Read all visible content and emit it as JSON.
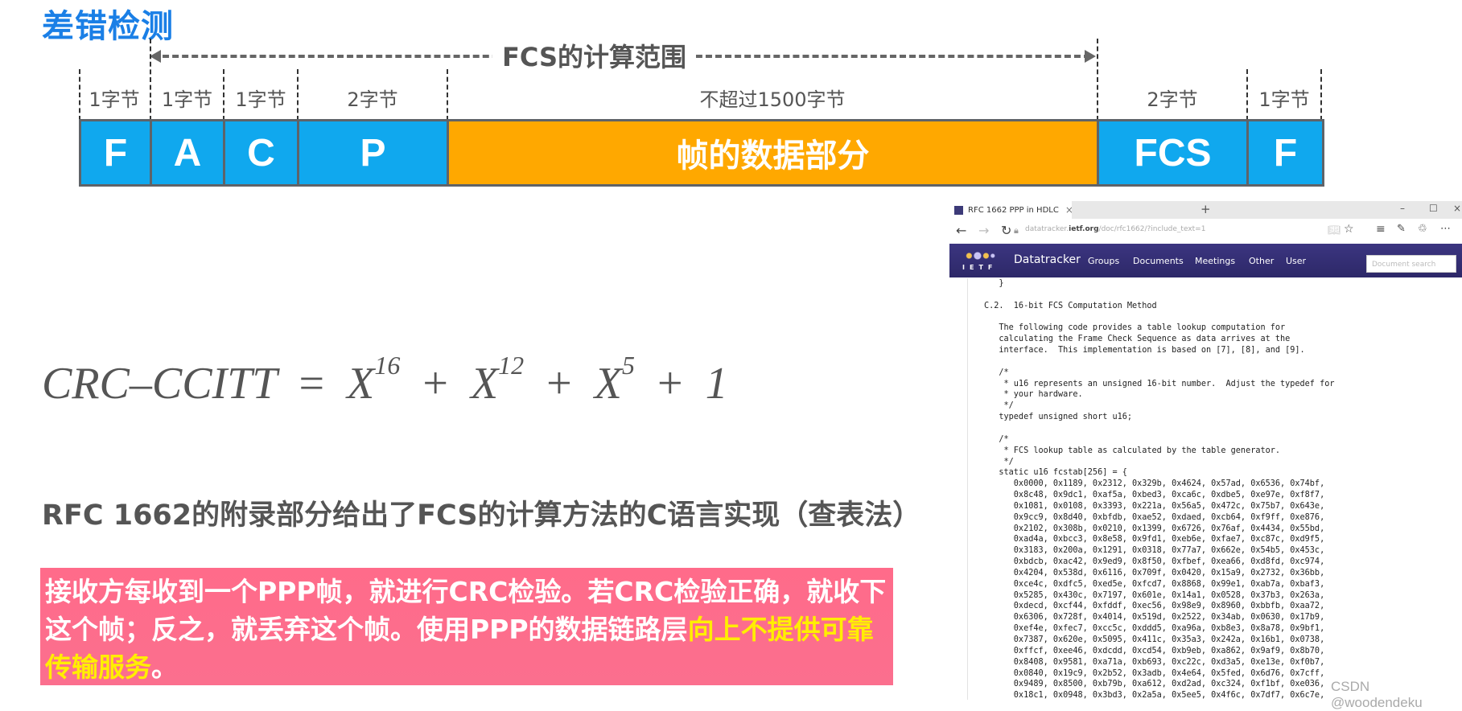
{
  "slide": {
    "title": "差错检测",
    "fcs_range_label": "FCS的计算范围",
    "frame_fields": [
      {
        "label": "F",
        "size": "1字节",
        "color": "#10a8ee"
      },
      {
        "label": "A",
        "size": "1字节",
        "color": "#10a8ee"
      },
      {
        "label": "C",
        "size": "1字节",
        "color": "#10a8ee"
      },
      {
        "label": "P",
        "size": "2字节",
        "color": "#10a8ee"
      },
      {
        "label": "帧的数据部分",
        "size": "不超过1500字节",
        "color": "#ffa800"
      },
      {
        "label": "FCS",
        "size": "2字节",
        "color": "#10a8ee"
      },
      {
        "label": "F",
        "size": "1字节",
        "color": "#10a8ee"
      }
    ],
    "formula": {
      "lhs": "CRC–CCITT",
      "eq": "=",
      "terms": [
        {
          "base": "X",
          "exp": "16"
        },
        {
          "base": "X",
          "exp": "12"
        },
        {
          "base": "X",
          "exp": "5"
        },
        {
          "base": "1",
          "exp": ""
        }
      ],
      "plus": "+"
    },
    "rfc_note": "RFC 1662的附录部分给出了FCS的计算方法的C语言实现（查表法）",
    "conclusion_white": "接收方每收到一个PPP帧，就进行CRC检验。若CRC检验正确，就收下这个帧；反之，就丢弃这个帧。使用PPP的数据链路层",
    "conclusion_yellow": "向上不提供可靠传输服务",
    "conclusion_end": "。",
    "watermark": "CSDN @woodendeku"
  },
  "browser": {
    "tab_title": "RFC 1662   PPP in HDLC",
    "tab_close": "×",
    "new_tab": "+",
    "win_min": "–",
    "win_max": "☐",
    "win_close": "×",
    "url_prefix": "datatracker.",
    "url_domain": "ietf.org",
    "url_path": "/doc/rfc1662/?include_text=1",
    "ietf_logo_text": "IETF",
    "nav": {
      "brand": "Datatracker",
      "items": [
        "Groups",
        "Documents",
        "Meetings",
        "Other",
        "User"
      ]
    },
    "search_placeholder": "Document search",
    "document_text": "   }\n\nC.2.  16-bit FCS Computation Method\n\n   The following code provides a table lookup computation for\n   calculating the Frame Check Sequence as data arrives at the\n   interface.  This implementation is based on [7], [8], and [9].\n\n   /*\n    * u16 represents an unsigned 16-bit number.  Adjust the typedef for\n    * your hardware.\n    */\n   typedef unsigned short u16;\n\n   /*\n    * FCS lookup table as calculated by the table generator.\n    */\n   static u16 fcstab[256] = {\n      0x0000, 0x1189, 0x2312, 0x329b, 0x4624, 0x57ad, 0x6536, 0x74bf,\n      0x8c48, 0x9dc1, 0xaf5a, 0xbed3, 0xca6c, 0xdbe5, 0xe97e, 0xf8f7,\n      0x1081, 0x0108, 0x3393, 0x221a, 0x56a5, 0x472c, 0x75b7, 0x643e,\n      0x9cc9, 0x8d40, 0xbfdb, 0xae52, 0xdaed, 0xcb64, 0xf9ff, 0xe876,\n      0x2102, 0x308b, 0x0210, 0x1399, 0x6726, 0x76af, 0x4434, 0x55bd,\n      0xad4a, 0xbcc3, 0x8e58, 0x9fd1, 0xeb6e, 0xfae7, 0xc87c, 0xd9f5,\n      0x3183, 0x200a, 0x1291, 0x0318, 0x77a7, 0x662e, 0x54b5, 0x453c,\n      0xbdcb, 0xac42, 0x9ed9, 0x8f50, 0xfbef, 0xea66, 0xd8fd, 0xc974,\n      0x4204, 0x538d, 0x6116, 0x709f, 0x0420, 0x15a9, 0x2732, 0x36bb,\n      0xce4c, 0xdfc5, 0xed5e, 0xfcd7, 0x8868, 0x99e1, 0xab7a, 0xbaf3,\n      0x5285, 0x430c, 0x7197, 0x601e, 0x14a1, 0x0528, 0x37b3, 0x263a,\n      0xdecd, 0xcf44, 0xfddf, 0xec56, 0x98e9, 0x8960, 0xbbfb, 0xaa72,\n      0x6306, 0x728f, 0x4014, 0x519d, 0x2522, 0x34ab, 0x0630, 0x17b9,\n      0xef4e, 0xfec7, 0xcc5c, 0xddd5, 0xa96a, 0xb8e3, 0x8a78, 0x9bf1,\n      0x7387, 0x620e, 0x5095, 0x411c, 0x35a3, 0x242a, 0x16b1, 0x0738,\n      0xffcf, 0xee46, 0xdcdd, 0xcd54, 0xb9eb, 0xa862, 0x9af9, 0x8b70,\n      0x8408, 0x9581, 0xa71a, 0xb693, 0xc22c, 0xd3a5, 0xe13e, 0xf0b7,\n      0x0840, 0x19c9, 0x2b52, 0x3adb, 0x4e64, 0x5fed, 0x6d76, 0x7cff,\n      0x9489, 0x8500, 0xb79b, 0xa612, 0xd2ad, 0xc324, 0xf1bf, 0xe036,\n      0x18c1, 0x0948, 0x3bd3, 0x2a5a, 0x5ee5, 0x4f6c, 0x7df7, 0x6c7e,"
  }
}
